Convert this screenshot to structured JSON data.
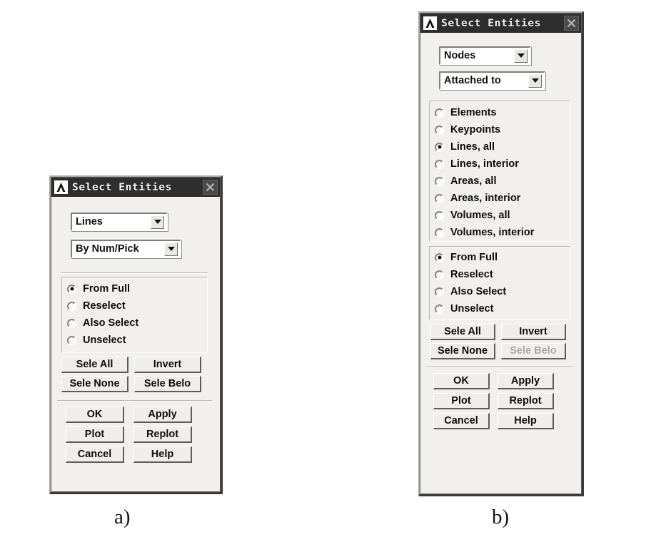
{
  "figure": {
    "captions": [
      {
        "id": "caption-a",
        "text": "a)"
      },
      {
        "id": "caption-b",
        "text": "b)"
      }
    ]
  },
  "colors": {
    "titlebar_bg": "#2e2e2e",
    "dialog_bg": "#f1f0ef",
    "title_text": "#f4f4f4",
    "button_face": "#efeeec",
    "disabled_text": "#a6a5a3",
    "field_bg": "#ffffff"
  },
  "panel_a": {
    "title": "Select Entities",
    "logo_icon": "ansys-a-logo-icon",
    "close_icon": "close-icon",
    "entity_combo": {
      "value": "Lines",
      "arrow_icon": "chevron-down-icon"
    },
    "criteria_combo": {
      "value": "By Num/Pick",
      "arrow_icon": "chevron-down-icon"
    },
    "mode_radios": [
      {
        "label": "From Full",
        "checked": true
      },
      {
        "label": "Reselect",
        "checked": false
      },
      {
        "label": "Also Select",
        "checked": false
      },
      {
        "label": "Unselect",
        "checked": false
      }
    ],
    "select_buttons": [
      {
        "label": "Sele All",
        "disabled": false
      },
      {
        "label": "Invert",
        "disabled": false
      },
      {
        "label": "Sele None",
        "disabled": false
      },
      {
        "label": "Sele Belo",
        "disabled": false
      }
    ],
    "action_buttons": [
      {
        "label": "OK",
        "disabled": false
      },
      {
        "label": "Apply",
        "disabled": false
      },
      {
        "label": "Plot",
        "disabled": false
      },
      {
        "label": "Replot",
        "disabled": false
      },
      {
        "label": "Cancel",
        "disabled": false
      },
      {
        "label": "Help",
        "disabled": false
      }
    ]
  },
  "panel_b": {
    "title": "Select Entities",
    "logo_icon": "ansys-a-logo-icon",
    "close_icon": "close-icon",
    "entity_combo": {
      "value": "Nodes",
      "arrow_icon": "chevron-down-icon"
    },
    "criteria_combo": {
      "value": "Attached to",
      "arrow_icon": "chevron-down-icon"
    },
    "attached_radios": [
      {
        "label": "Elements",
        "checked": false
      },
      {
        "label": "Keypoints",
        "checked": false
      },
      {
        "label": "Lines, all",
        "checked": true
      },
      {
        "label": "Lines, interior",
        "checked": false
      },
      {
        "label": "Areas, all",
        "checked": false
      },
      {
        "label": "Areas, interior",
        "checked": false
      },
      {
        "label": "Volumes, all",
        "checked": false
      },
      {
        "label": "Volumes, interior",
        "checked": false
      }
    ],
    "mode_radios": [
      {
        "label": "From Full",
        "checked": true
      },
      {
        "label": "Reselect",
        "checked": false
      },
      {
        "label": "Also Select",
        "checked": false
      },
      {
        "label": "Unselect",
        "checked": false
      }
    ],
    "select_buttons": [
      {
        "label": "Sele All",
        "disabled": false
      },
      {
        "label": "Invert",
        "disabled": false
      },
      {
        "label": "Sele None",
        "disabled": false
      },
      {
        "label": "Sele Belo",
        "disabled": true
      }
    ],
    "action_buttons": [
      {
        "label": "OK",
        "disabled": false
      },
      {
        "label": "Apply",
        "disabled": false
      },
      {
        "label": "Plot",
        "disabled": false
      },
      {
        "label": "Replot",
        "disabled": false
      },
      {
        "label": "Cancel",
        "disabled": false
      },
      {
        "label": "Help",
        "disabled": false
      }
    ]
  }
}
